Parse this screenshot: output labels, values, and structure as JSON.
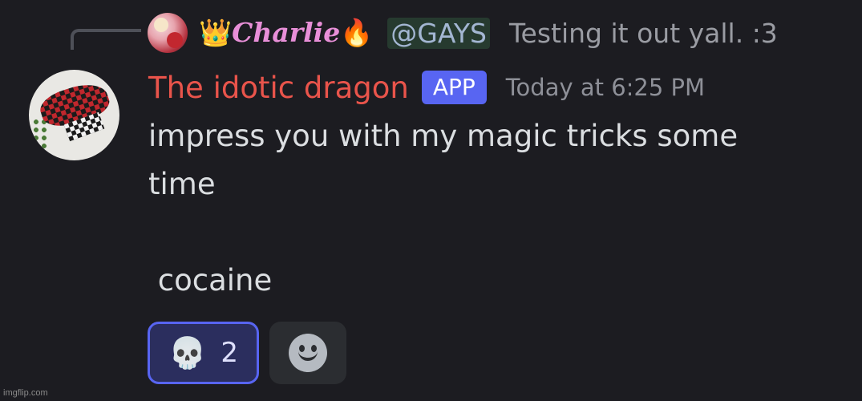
{
  "reply": {
    "author_prefix_emoji": "👑",
    "author_name": "Charlie",
    "author_suffix_emoji": "🔥",
    "mention": "@GAYS",
    "text": "Testing it out yall. :3"
  },
  "message": {
    "username": "The idotic dragon",
    "badge": "APP",
    "timestamp": "Today at 6:25 PM",
    "lines": [
      "impress you with my magic tricks some",
      "time",
      "",
      " cocaine"
    ]
  },
  "reactions": [
    {
      "emoji": "💀",
      "count": "2",
      "active": true
    }
  ],
  "add_reaction_icon": "smiley-add-reaction-icon",
  "colors": {
    "background": "#1c1c21",
    "username": "#e9544b",
    "badge": "#5865f2",
    "reply_name": "#e88fd8",
    "mention_bg": "#263a2f",
    "reaction_border": "#5865f2"
  },
  "watermark": "imgflip.com"
}
